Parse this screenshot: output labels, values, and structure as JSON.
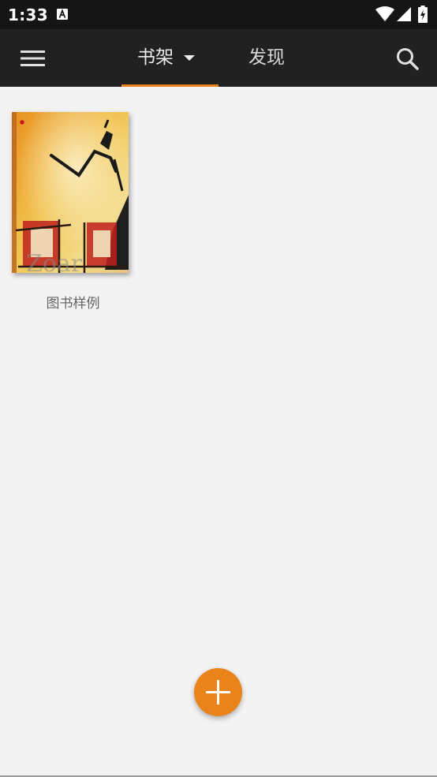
{
  "status_bar": {
    "time": "1:33",
    "notification_icon": "a-icon",
    "icons": [
      "wifi-icon",
      "signal-icon",
      "battery-charging-icon"
    ]
  },
  "app_bar": {
    "menu_icon": "hamburger-menu-icon",
    "tabs": [
      {
        "label": "书架",
        "selected": true,
        "has_dropdown": true
      },
      {
        "label": "发现",
        "selected": false
      }
    ],
    "search_icon": "search-icon"
  },
  "bookshelf": {
    "books": [
      {
        "title": "图书样例"
      }
    ]
  },
  "fab": {
    "icon": "plus-icon"
  },
  "colors": {
    "accent": "#e97f1a",
    "app_bar": "#212121",
    "status_bar": "#151515",
    "background": "#f3f3f3"
  }
}
